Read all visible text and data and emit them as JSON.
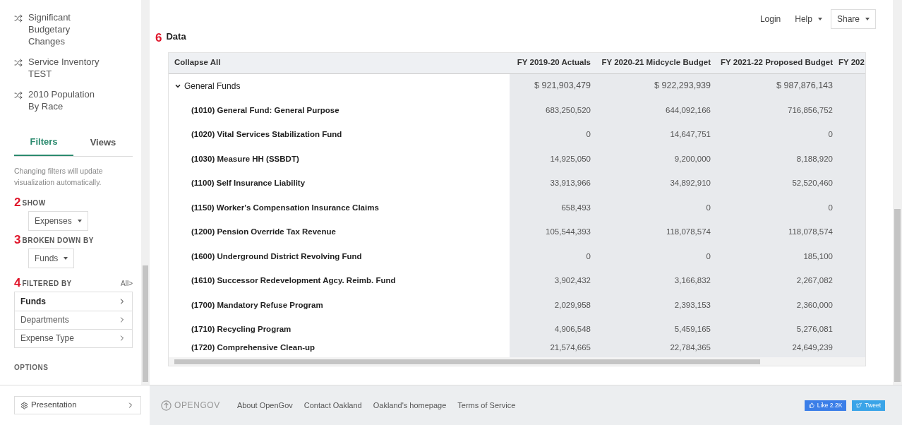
{
  "sidebar": {
    "reports": [
      {
        "label": "Significant Budgetary Changes"
      },
      {
        "label": "Service Inventory TEST"
      },
      {
        "label": "2010 Population By Race"
      }
    ],
    "tabs": [
      {
        "label": "Filters",
        "selected": true
      },
      {
        "label": "Views",
        "selected": false
      }
    ],
    "note": "Changing filters will update visualization automatically.",
    "show": {
      "marker": "2",
      "label": "SHOW",
      "value": "Expenses"
    },
    "broken_down_by": {
      "marker": "3",
      "label": "BROKEN DOWN BY",
      "value": "Funds"
    },
    "filtered_by": {
      "marker": "4",
      "label": "FILTERED BY",
      "all_link": "All>",
      "items": [
        {
          "label": "Funds",
          "selected": true
        },
        {
          "label": "Departments",
          "selected": false
        },
        {
          "label": "Expense Type",
          "selected": false
        }
      ]
    },
    "options": "OPTIONS",
    "presentation": "Presentation"
  },
  "top_nav": {
    "login": "Login",
    "help": "Help",
    "share": "Share"
  },
  "data_section": {
    "marker": "6",
    "title": "Data"
  },
  "table": {
    "collapse": "Collapse All",
    "columns": [
      "FY 2019-20 Actuals",
      "FY 2020-21 Midcycle Budget",
      "FY 2021-22 Proposed Budget",
      "FY 202"
    ],
    "group": {
      "label": "General Funds",
      "expanded": true,
      "values": [
        "$ 921,903,479",
        "$ 922,293,939",
        "$ 987,876,143"
      ]
    },
    "rows": [
      {
        "name": "(1010) General Fund: General Purpose",
        "values": [
          "683,250,520",
          "644,092,166",
          "716,856,752"
        ]
      },
      {
        "name": "(1020) Vital Services Stabilization Fund",
        "values": [
          "0",
          "14,647,751",
          "0"
        ]
      },
      {
        "name": "(1030) Measure HH (SSBDT)",
        "values": [
          "14,925,050",
          "9,200,000",
          "8,188,920"
        ]
      },
      {
        "name": "(1100) Self Insurance Liability",
        "values": [
          "33,913,966",
          "34,892,910",
          "52,520,460"
        ]
      },
      {
        "name": "(1150) Worker's Compensation Insurance Claims",
        "values": [
          "658,493",
          "0",
          "0"
        ]
      },
      {
        "name": "(1200) Pension Override Tax Revenue",
        "values": [
          "105,544,393",
          "118,078,574",
          "118,078,574"
        ]
      },
      {
        "name": "(1600) Underground District Revolving Fund",
        "values": [
          "0",
          "0",
          "185,100"
        ]
      },
      {
        "name": "(1610) Successor Redevelopment Agcy. Reimb. Fund",
        "values": [
          "3,902,432",
          "3,166,832",
          "2,267,082"
        ]
      },
      {
        "name": "(1700) Mandatory Refuse Program",
        "values": [
          "2,029,958",
          "2,393,153",
          "2,360,000"
        ]
      },
      {
        "name": "(1710) Recycling Program",
        "values": [
          "4,906,548",
          "5,459,165",
          "5,276,081"
        ]
      },
      {
        "name": "(1720) Comprehensive Clean-up",
        "values": [
          "21,574,665",
          "22,784,365",
          "24,649,239"
        ]
      }
    ]
  },
  "footer": {
    "logo": "OPENGOV",
    "links": [
      "About OpenGov",
      "Contact Oakland",
      "Oakland's homepage",
      "Terms of Service"
    ],
    "like": "Like 2.2K",
    "tweet": "Tweet"
  }
}
